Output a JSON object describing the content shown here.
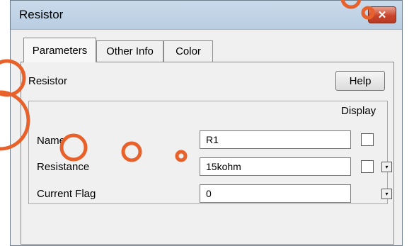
{
  "window": {
    "title": "Resistor",
    "close_symbol": "✕"
  },
  "tabs": [
    {
      "label": "Parameters",
      "active": true
    },
    {
      "label": "Other Info",
      "active": false
    },
    {
      "label": "Color",
      "active": false
    }
  ],
  "panel": {
    "section_title": "Resistor",
    "help_label": "Help",
    "display_header": "Display",
    "rows": [
      {
        "label": "Name",
        "value": "R1",
        "display_checked": false
      },
      {
        "label": "Resistance",
        "value": "15kohm",
        "display_checked": false
      },
      {
        "label": "Current Flag",
        "value": "0"
      }
    ],
    "dropdown_arrow": "▾"
  },
  "colors": {
    "annotation": "#e8612a",
    "titlebar": "#c3d5e9",
    "close": "#c8452c"
  }
}
